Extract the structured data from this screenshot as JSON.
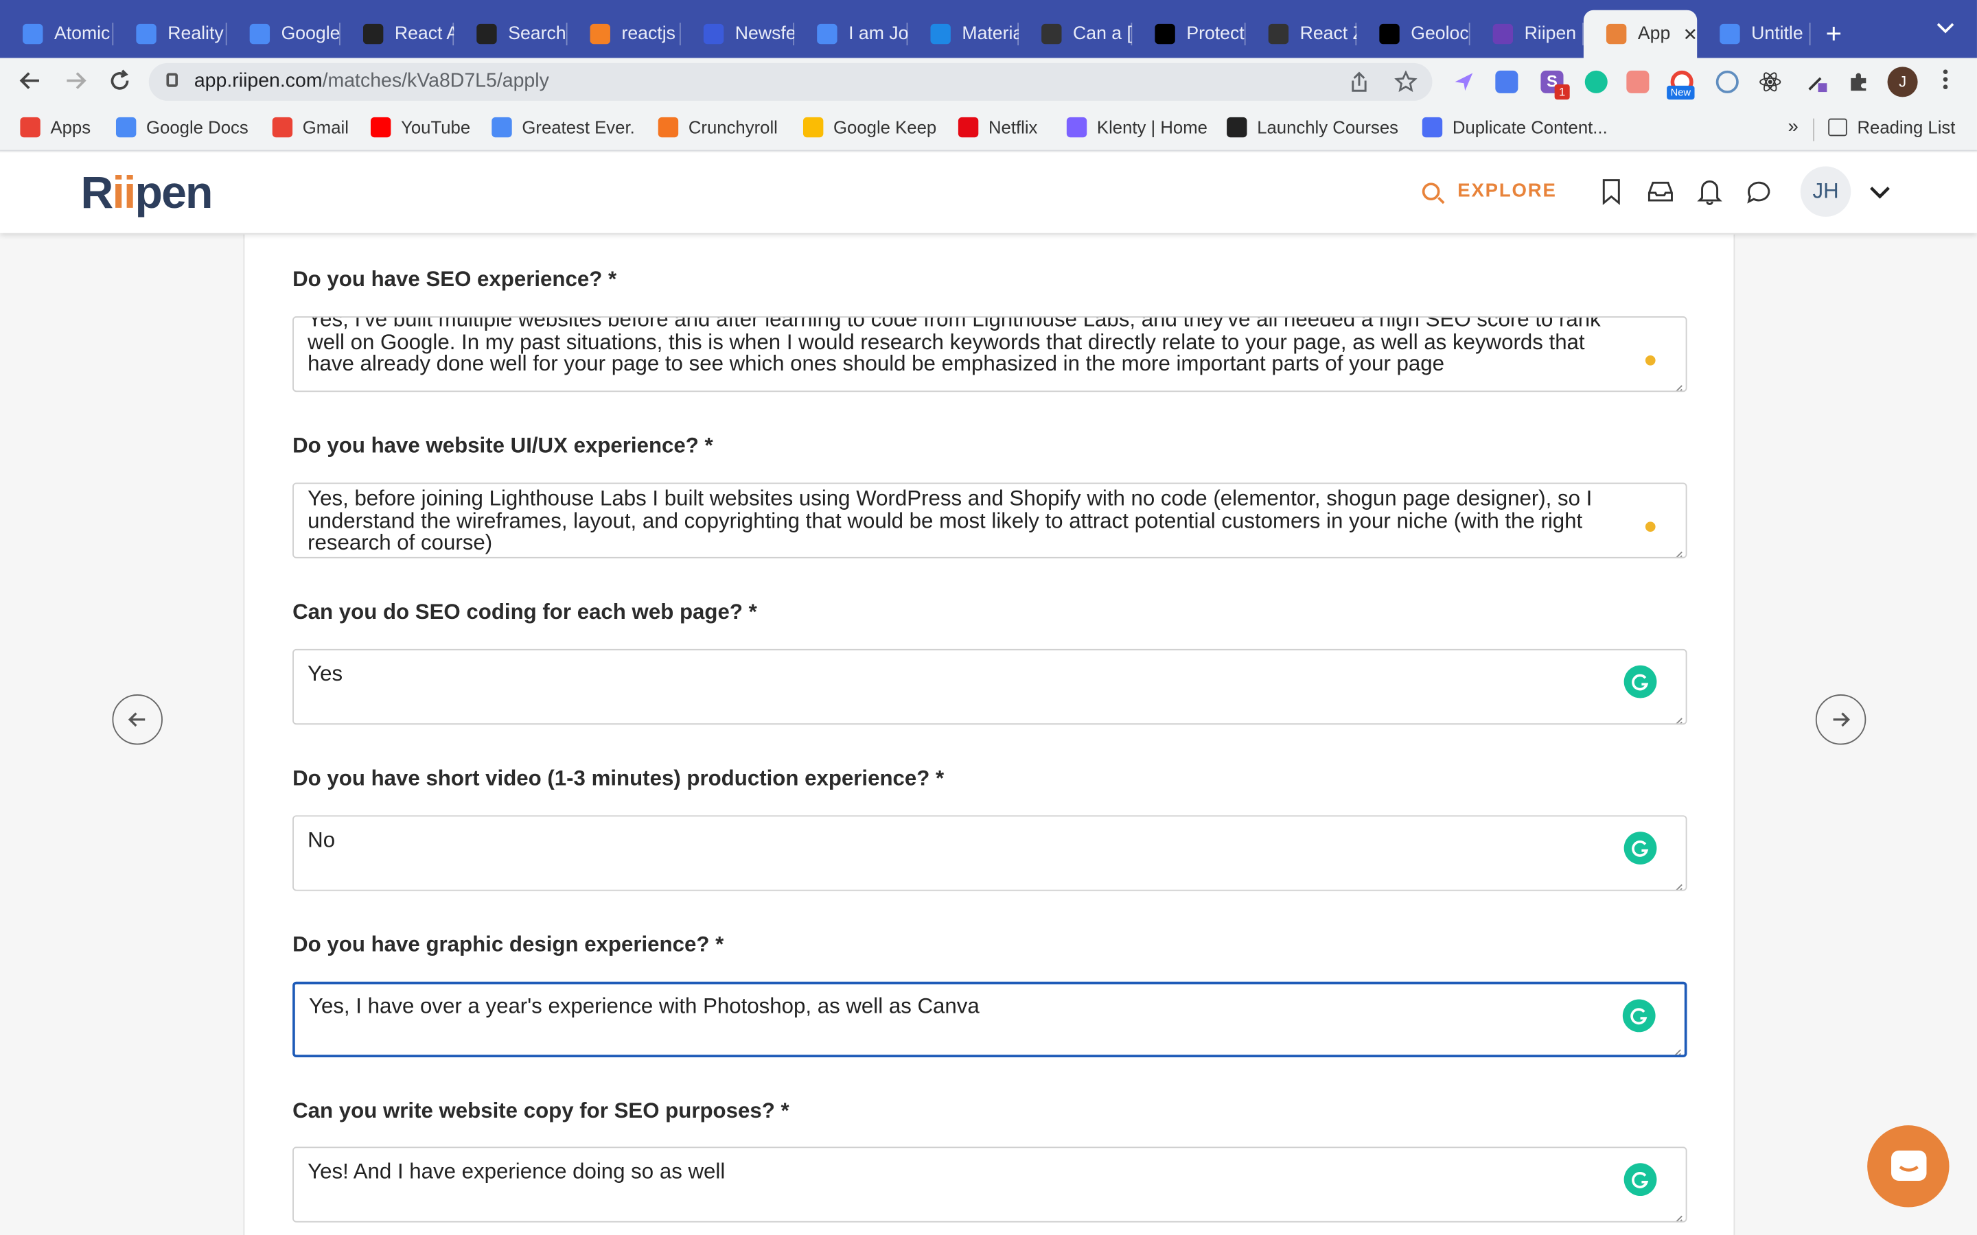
{
  "browser": {
    "tabs": [
      {
        "title": "Atomic",
        "icon": "docs-icon",
        "color": "#4c8bf5"
      },
      {
        "title": "Reality",
        "icon": "docs-icon",
        "color": "#4c8bf5"
      },
      {
        "title": "Google",
        "icon": "docs-icon",
        "color": "#4c8bf5"
      },
      {
        "title": "React A",
        "icon": "react-icon",
        "color": "#222222"
      },
      {
        "title": "Search",
        "icon": "search-tab-icon",
        "color": "#222222"
      },
      {
        "title": "reactjs",
        "icon": "stackoverflow-icon",
        "color": "#f48024"
      },
      {
        "title": "Newsfe",
        "icon": "newsfeed-icon",
        "color": "#3b5bdb"
      },
      {
        "title": "I am Jo",
        "icon": "docs-icon",
        "color": "#4c8bf5"
      },
      {
        "title": "Materia",
        "icon": "material-icon",
        "color": "#1e88e5"
      },
      {
        "title": "Can a [",
        "icon": "link-icon",
        "color": "#333333"
      },
      {
        "title": "Protect",
        "icon": "dev-icon",
        "color": "#000000"
      },
      {
        "title": "React Z",
        "icon": "triangle-icon",
        "color": "#333333"
      },
      {
        "title": "Geoloc",
        "icon": "geo-icon",
        "color": "#000000"
      },
      {
        "title": "Riipen",
        "icon": "list-icon",
        "color": "#6a3fb5"
      },
      {
        "title": "App",
        "icon": "riipen-icon",
        "color": "#e8833a",
        "active": true
      },
      {
        "title": "Untitle",
        "icon": "docs-icon",
        "color": "#4c8bf5"
      }
    ],
    "address": {
      "host": "app.riipen.com",
      "path": "/matches/kVa8D7L5/apply"
    },
    "profile_initial": "J",
    "ext_badge_count": "1",
    "ext_new_label": "New",
    "bookmarks": [
      {
        "label": "Apps",
        "icon": "apps-icon",
        "color": "#e94235"
      },
      {
        "label": "Google Docs",
        "icon": "docs-icon",
        "color": "#4c8bf5"
      },
      {
        "label": "Gmail",
        "icon": "gmail-icon",
        "color": "#ea4335"
      },
      {
        "label": "YouTube",
        "icon": "youtube-icon",
        "color": "#ff0000"
      },
      {
        "label": "Greatest Ever.",
        "icon": "calendar-icon",
        "color": "#4c8bf5"
      },
      {
        "label": "Crunchyroll",
        "icon": "crunchyroll-icon",
        "color": "#f47521"
      },
      {
        "label": "Google Keep",
        "icon": "keep-icon",
        "color": "#fbbc04"
      },
      {
        "label": "Netflix",
        "icon": "netflix-icon",
        "color": "#e50914"
      },
      {
        "label": "Klenty | Home",
        "icon": "klenty-icon",
        "color": "#7b61ff"
      },
      {
        "label": "Launchly Courses",
        "icon": "launchly-icon",
        "color": "#222222"
      },
      {
        "label": "Duplicate Content...",
        "icon": "m-icon",
        "color": "#4c6ef5"
      }
    ],
    "bookmarks_more": "»",
    "reading_list": "Reading List"
  },
  "app": {
    "logo": "Riipen",
    "explore_label": "EXPLORE",
    "avatar_initials": "JH"
  },
  "form": {
    "questions": [
      {
        "label": "Do you have SEO experience? *",
        "answer": "Yes, I've built multiple websites before and after learning to code from Lighthouse Labs, and they've all needed a high SEO score to rank well on Google. In my past situations, this is when I would research keywords that directly relate to your page, as well as keywords that have already done well for your page to see which ones should be emphasized in the more important parts of your page",
        "indicator": "dot"
      },
      {
        "label": "Do you have website UI/UX experience? *",
        "answer": "Yes, before joining Lighthouse Labs I built websites using WordPress and Shopify with no code (elementor, shogun page designer), so I understand the wireframes, layout, and copyrighting that would be most likely to attract potential customers in your niche (with the right research of course)",
        "indicator": "dot"
      },
      {
        "label": "Can you do SEO coding for each web page? *",
        "answer": "Yes",
        "indicator": "grammarly"
      },
      {
        "label": "Do you have short video (1-3 minutes) production experience? *",
        "answer": "No",
        "indicator": "grammarly"
      },
      {
        "label": "Do you have graphic design experience? *",
        "answer": "Yes, I have over a year's experience with Photoshop, as well as Canva",
        "indicator": "grammarly",
        "focused": true
      },
      {
        "label": "Can you write website copy for SEO purposes? *",
        "answer": "Yes! And I have experience doing so as well",
        "indicator": "grammarly"
      }
    ]
  },
  "colors": {
    "accent": "#e8833a",
    "grammarly": "#15c39a",
    "focus": "#1e5bb8",
    "tabstrip": "#3b4fa8"
  }
}
